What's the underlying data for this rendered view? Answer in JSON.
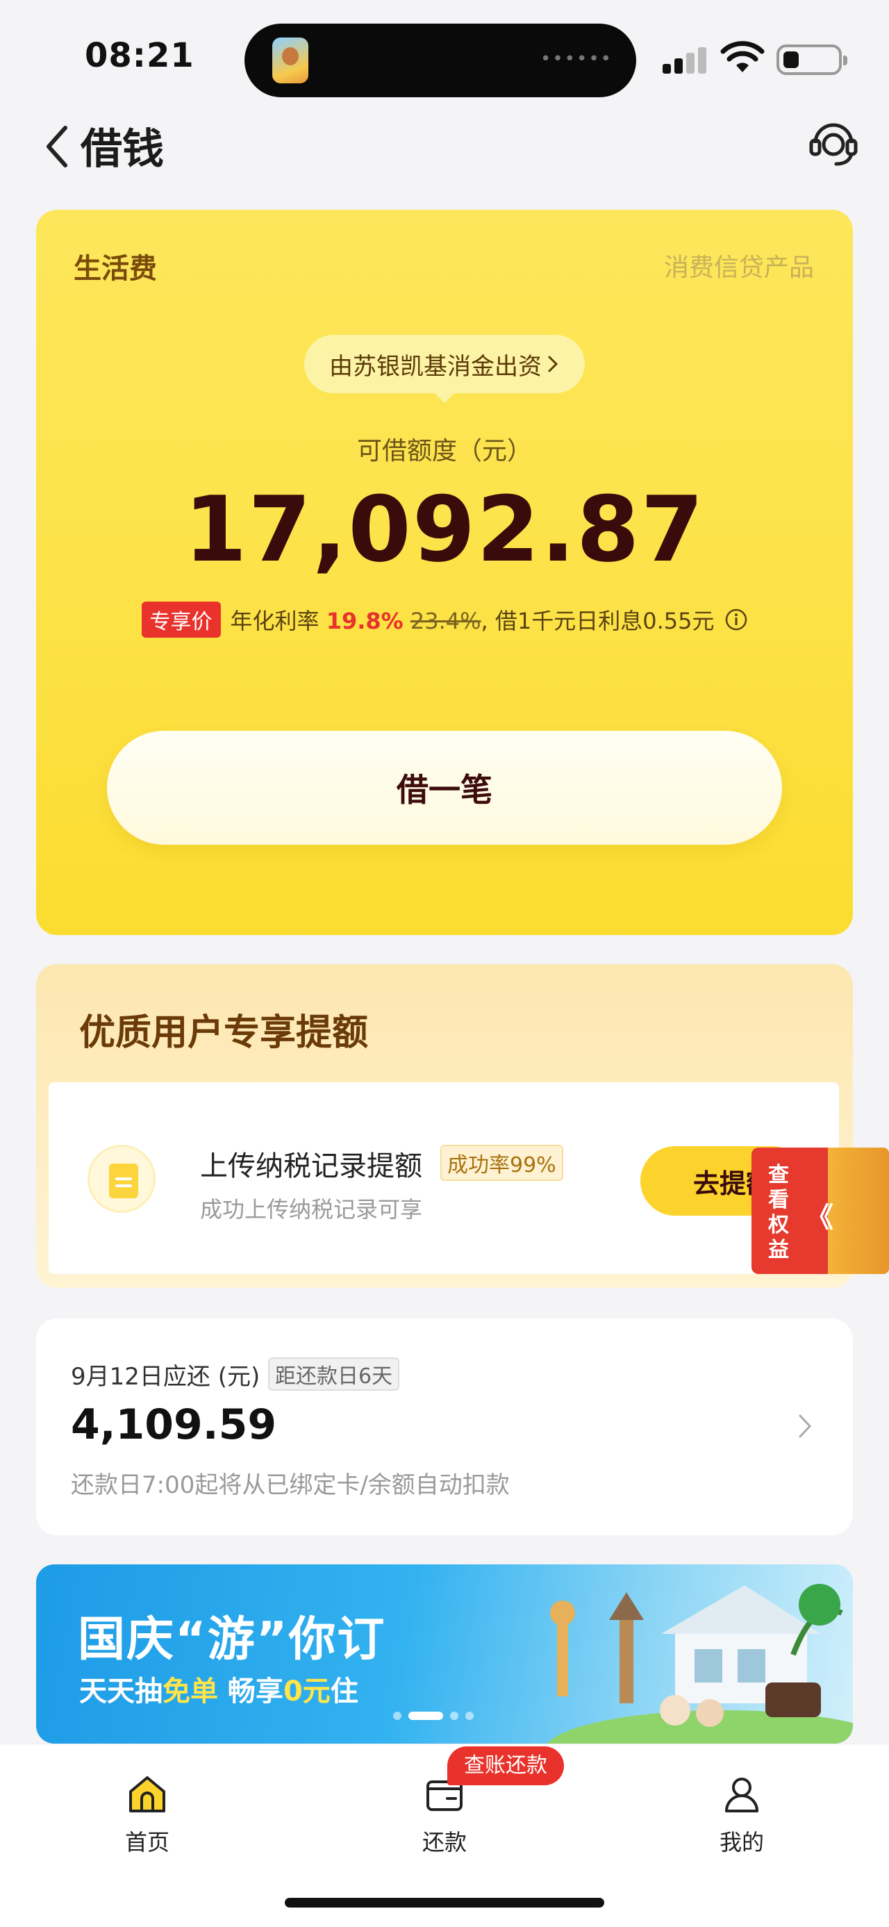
{
  "status_bar": {
    "time": "08:21",
    "island_dots": "••••••"
  },
  "nav": {
    "title": "借钱"
  },
  "loan_card": {
    "label": "生活费",
    "tag": "消费信贷产品",
    "funder": "由苏银凯基消金出资",
    "quota_label": "可借额度（元）",
    "quota_amount": "17,092.87",
    "rate_badge": "专享价",
    "rate_prefix": "年化利率",
    "rate_current": "19.8%",
    "rate_old": "23.4%",
    "rate_suffix": ", 借1千元日利息0.55元",
    "borrow_button": "借一笔"
  },
  "premium": {
    "title": "优质用户专享提额",
    "item_title": "上传纳税记录提额",
    "item_rate": "成功率99%",
    "item_sub": "成功上传纳税记录可享",
    "go_button": "去提额",
    "benefit_lines": [
      "查",
      "看",
      "权",
      "益"
    ],
    "benefit_arrow": "《"
  },
  "repayment": {
    "date_label": "9月12日应还 (元)",
    "days_tag": "距还款日6天",
    "amount": "4,109.59",
    "note": "还款日7:00起将从已绑定卡/余额自动扣款"
  },
  "banner": {
    "title": "国庆“游”你订",
    "sub_1": "天天抽",
    "sub_2": "免单",
    "sub_3": " 畅享",
    "sub_4": "0元",
    "sub_5": "住",
    "active_dot": 1
  },
  "tab_bar": {
    "items": [
      {
        "label": "首页",
        "icon": "home-icon"
      },
      {
        "label": "还款",
        "icon": "wallet-icon"
      },
      {
        "label": "我的",
        "icon": "user-icon"
      }
    ],
    "badge": "查账还款"
  },
  "colors": {
    "accent_yellow": "#fde247",
    "brand_dark": "#3a0b0b",
    "discount_red": "#e8322b"
  }
}
